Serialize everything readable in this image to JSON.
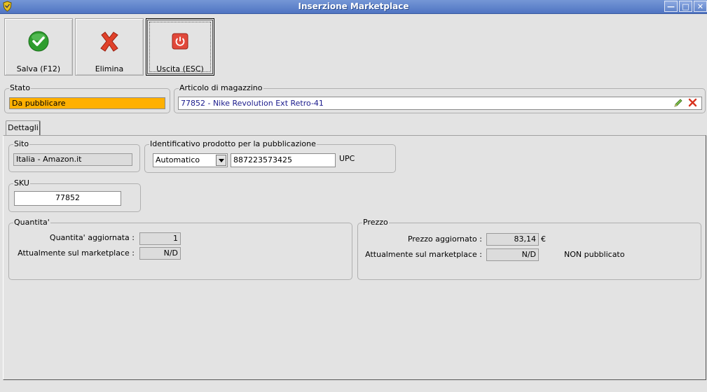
{
  "window": {
    "title": "Inserzione Marketplace",
    "app_icon": "shield-icon",
    "controls": [
      "minimize-icon",
      "maximize-icon",
      "close-icon"
    ]
  },
  "toolbar": {
    "save_label": "Salva (F12)",
    "delete_label": "Elimina",
    "exit_label": "Uscita (ESC)"
  },
  "status": {
    "legend": "Stato",
    "value": "Da pubblicare",
    "color": "#ffb000"
  },
  "article": {
    "legend": "Articolo di magazzino",
    "value": "77852 - Nike Revolution Ext Retro-41",
    "text_color": "#1a1a8c"
  },
  "tabs": [
    {
      "label": "Dettagli",
      "active": true
    }
  ],
  "site": {
    "legend": "Sito",
    "value": "Italia - Amazon.it"
  },
  "product_id": {
    "legend": "Identificativo prodotto per la pubblicazione",
    "select_value": "Automatico",
    "code_value": "887223573425",
    "type_label": "UPC"
  },
  "sku": {
    "legend": "SKU",
    "value": "77852"
  },
  "quantity": {
    "legend": "Quantita'",
    "updated_label": "Quantita' aggiornata :",
    "updated_value": "1",
    "current_label": "Attualmente sul marketplace :",
    "current_value": "N/D"
  },
  "price": {
    "legend": "Prezzo",
    "updated_label": "Prezzo aggiornato :",
    "updated_value": "83,14",
    "currency": "€",
    "current_label": "Attualmente sul marketplace :",
    "current_value": "N/D",
    "publish_status": "NON pubblicato"
  }
}
